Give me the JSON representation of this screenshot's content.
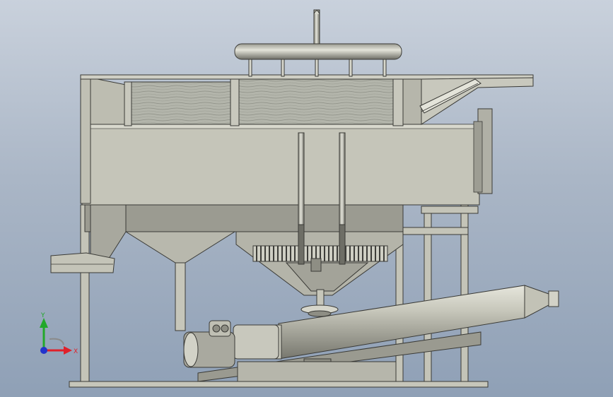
{
  "triad": {
    "x_label": "X",
    "y_label": "Y",
    "x_color": "#e0202a",
    "y_color": "#22a82a",
    "z_color": "#2233cc"
  },
  "colors": {
    "steel": "#c9c9bd",
    "steel_dark": "#8e8e84",
    "edge": "#3a3a36",
    "screen": "#aeb0a6"
  }
}
